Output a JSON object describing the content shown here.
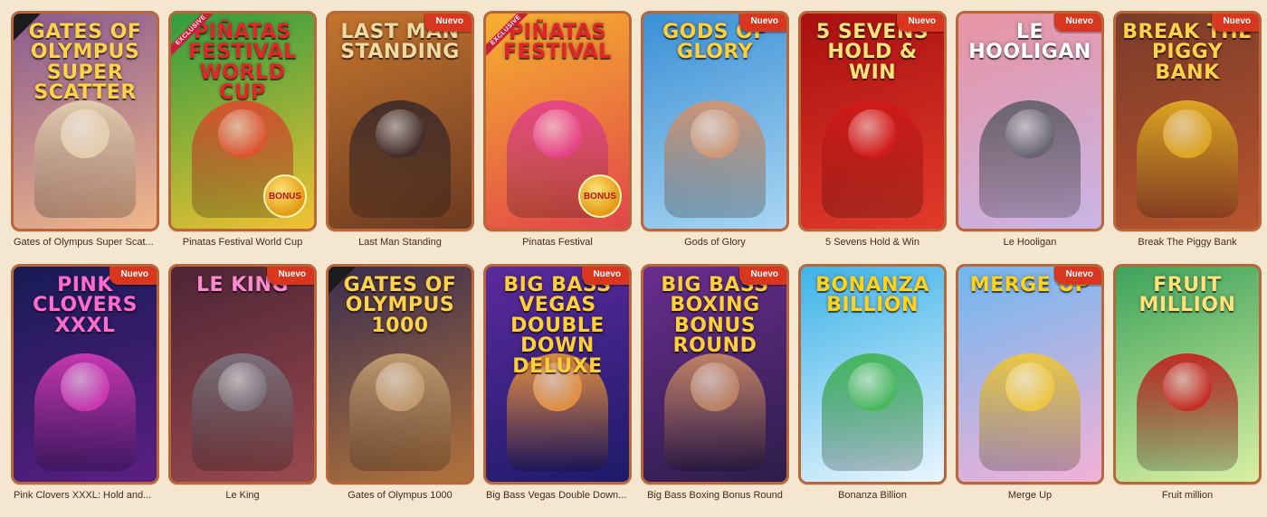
{
  "badge_new_label": "Nuevo",
  "bonus_label": "BONUS",
  "exclusive_label": "EXCLUSIVE",
  "games": [
    {
      "title": "Gates of Olympus Super Scat...",
      "logo": "Gates of OLYMPUS SUPER SCATTER",
      "new": false,
      "exclusive": false,
      "corner": true,
      "bonus": false,
      "bg": "#8a5a8f",
      "bg2": "#f1b88a",
      "logoColor": "#ffd24a",
      "figure": "#e7d4b0",
      "align": "left"
    },
    {
      "title": "Pinatas Festival World Cup",
      "logo": "PIÑATAS Festival WORLD CUP",
      "new": false,
      "exclusive": true,
      "corner": false,
      "bonus": true,
      "bg": "#2e9c3f",
      "bg2": "#f1c232",
      "logoColor": "#e3252b",
      "figure": "#e24a2f",
      "align": "center"
    },
    {
      "title": "Last Man Standing",
      "logo": "LAST MAN STANDING",
      "new": true,
      "exclusive": false,
      "corner": false,
      "bonus": false,
      "bg": "#c4752d",
      "bg2": "#6b3a22",
      "logoColor": "#f2d9a2",
      "figure": "#3b2a2b",
      "align": "center"
    },
    {
      "title": "Pinatas Festival",
      "logo": "PIÑATAS Festival",
      "new": false,
      "exclusive": true,
      "corner": false,
      "bonus": true,
      "bg": "#f5b12f",
      "bg2": "#e2454a",
      "logoColor": "#e3252b",
      "figure": "#e63f8f",
      "align": "center"
    },
    {
      "title": "Gods of Glory",
      "logo": "GODS OF GLORY",
      "new": true,
      "exclusive": false,
      "corner": false,
      "bonus": false,
      "bg": "#3a8fd6",
      "bg2": "#a9d6f2",
      "logoColor": "#ffcf3a",
      "figure": "#d8946b",
      "align": "center"
    },
    {
      "title": "5 Sevens Hold & Win",
      "logo": "5 Sevens HOLD & WIN",
      "new": true,
      "exclusive": false,
      "corner": false,
      "bonus": false,
      "bg": "#a8100f",
      "bg2": "#e33a2a",
      "logoColor": "#ffe27a",
      "figure": "#d21a1a",
      "align": "center"
    },
    {
      "title": "Le Hooligan",
      "logo": "LE HOOLIGAN",
      "new": true,
      "exclusive": false,
      "corner": false,
      "bonus": false,
      "bg": "#e893a3",
      "bg2": "#c9b5e6",
      "logoColor": "#ffffff",
      "figure": "#5c5e68",
      "align": "center"
    },
    {
      "title": "Break The Piggy Bank",
      "logo": "BREAK THE PIGGY BANK",
      "new": true,
      "exclusive": false,
      "corner": false,
      "bonus": false,
      "bg": "#7a3b2a",
      "bg2": "#b8542c",
      "logoColor": "#ffd24a",
      "figure": "#e5b022",
      "align": "center"
    },
    {
      "title": "Pink Clovers XXXL: Hold and...",
      "logo": "PINK CLOVERS XXXL",
      "new": true,
      "exclusive": false,
      "corner": false,
      "bonus": false,
      "bg": "#171b55",
      "bg2": "#5b1e83",
      "logoColor": "#ff6bd1",
      "figure": "#d73ab8",
      "align": "left"
    },
    {
      "title": "Le King",
      "logo": "LE KING",
      "new": true,
      "exclusive": false,
      "corner": false,
      "bonus": false,
      "bg": "#4d2436",
      "bg2": "#9a4a4e",
      "logoColor": "#ff8ad0",
      "figure": "#7d7680",
      "align": "center"
    },
    {
      "title": "Gates of Olympus 1000",
      "logo": "GATES of OLYMPUS 1000",
      "new": false,
      "exclusive": false,
      "corner": true,
      "bonus": false,
      "bg": "#3b2d4f",
      "bg2": "#b0733b",
      "logoColor": "#ffd24a",
      "figure": "#caa273",
      "align": "center"
    },
    {
      "title": "Big Bass Vegas Double Down...",
      "logo": "BIG BASS VEGAS DOUBLE DOWN DELUXE",
      "new": true,
      "exclusive": false,
      "corner": false,
      "bonus": false,
      "bg": "#5b2a9b",
      "bg2": "#1d1a6a",
      "logoColor": "#ffcf3a",
      "figure": "#f39b3a",
      "align": "left"
    },
    {
      "title": "Big Bass Boxing Bonus Round",
      "logo": "BIG BASS BOXING BONUS ROUND",
      "new": true,
      "exclusive": false,
      "corner": false,
      "bonus": false,
      "bg": "#6a2d8f",
      "bg2": "#2c1d4a",
      "logoColor": "#ffcf3a",
      "figure": "#c98b62",
      "align": "center"
    },
    {
      "title": "Bonanza Billion",
      "logo": "BONANZA BILLION",
      "new": false,
      "exclusive": false,
      "corner": false,
      "bonus": false,
      "bg": "#3db3e8",
      "bg2": "#eaf6ff",
      "logoColor": "#ffd21e",
      "figure": "#3fb44d",
      "align": "center"
    },
    {
      "title": "Merge Up",
      "logo": "MERGE UP",
      "new": true,
      "exclusive": false,
      "corner": false,
      "bonus": false,
      "bg": "#6fb7ef",
      "bg2": "#f4b1d6",
      "logoColor": "#ffd21e",
      "figure": "#f3c934",
      "align": "center"
    },
    {
      "title": "Fruit million",
      "logo": "FRUIT MILLION",
      "new": false,
      "exclusive": false,
      "corner": false,
      "bonus": false,
      "bg": "#3da35b",
      "bg2": "#d9f0a3",
      "logoColor": "#ffe27a",
      "figure": "#c91d1d",
      "align": "center"
    }
  ]
}
